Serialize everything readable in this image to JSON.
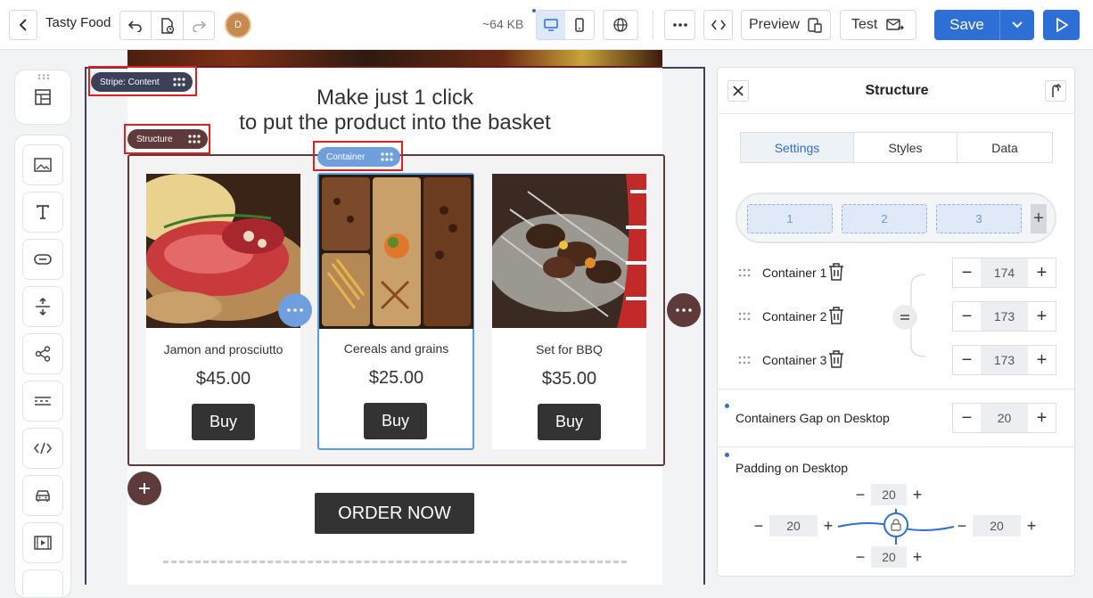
{
  "app": {
    "title": "Tasty Food",
    "avatar_initial": "D",
    "size_label": "~64 KB"
  },
  "toolbar": {
    "preview_label": "Preview",
    "test_label": "Test",
    "save_label": "Save"
  },
  "colors": {
    "accent": "#2e6fd6",
    "stripe_tag": "#3d4059",
    "structure_tag": "#5e3a3a",
    "container_tag": "#6fa0dd",
    "highlight": "#e02020"
  },
  "tags": {
    "stripe": "Stripe: Content",
    "structure": "Structure",
    "container": "Container"
  },
  "email": {
    "headline_line1": "Make just 1 click",
    "headline_line2": "to put the product into the basket",
    "products": [
      {
        "name": "Jamon and prosciutto",
        "price": "$45.00",
        "button": "Buy"
      },
      {
        "name": "Cereals and grains",
        "price": "$25.00",
        "button": "Buy"
      },
      {
        "name": "Set for BBQ",
        "price": "$35.00",
        "button": "Buy"
      }
    ],
    "order_label": "ORDER NOW"
  },
  "panel": {
    "title": "Structure",
    "tabs": [
      "Settings",
      "Styles",
      "Data"
    ],
    "active_tab": "Settings",
    "column_slots": [
      "1",
      "2",
      "3"
    ],
    "containers": [
      {
        "label": "Container 1",
        "width": "174"
      },
      {
        "label": "Container 2",
        "width": "173"
      },
      {
        "label": "Container 3",
        "width": "173"
      }
    ],
    "gap_label": "Containers Gap on Desktop",
    "gap_value": "20",
    "padding_label": "Padding on Desktop",
    "padding": {
      "top": "20",
      "left": "20",
      "right": "20",
      "bottom": "20"
    }
  },
  "icons": [
    "back-icon",
    "undo-icon",
    "version-history-icon",
    "redo-icon",
    "desktop-icon",
    "mobile-icon",
    "globe-icon",
    "more-icon",
    "code-icon",
    "preview-device-icon",
    "send-test-icon",
    "chevron-down-icon",
    "play-icon",
    "layout-icon",
    "image-icon",
    "text-icon",
    "button-icon",
    "spacer-icon",
    "social-icon",
    "divider-icon",
    "html-icon",
    "amp-icon",
    "video-icon",
    "close-icon",
    "export-icon",
    "trash-icon",
    "drag-icon",
    "lock-icon",
    "plus-icon"
  ]
}
